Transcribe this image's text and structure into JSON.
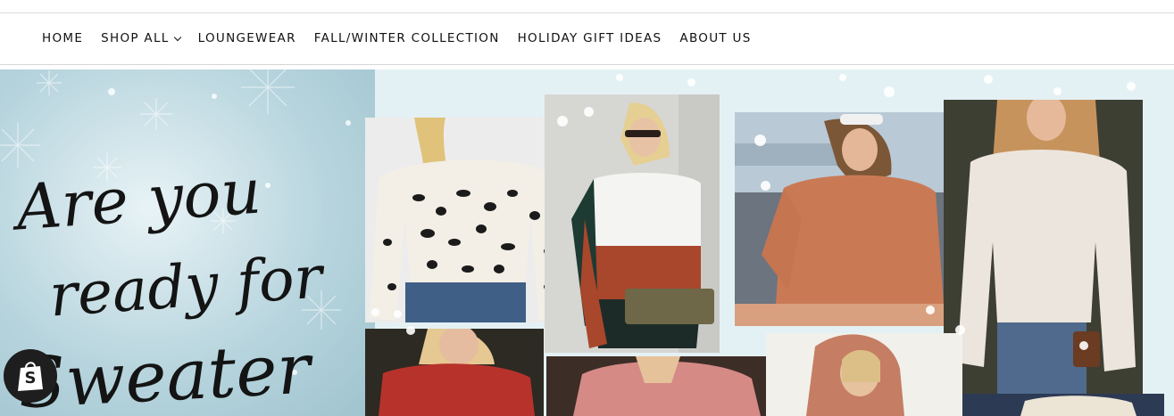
{
  "nav": {
    "items": [
      {
        "label": "HOME"
      },
      {
        "label": "SHOP ALL",
        "has_dropdown": true
      },
      {
        "label": "LOUNGEWEAR"
      },
      {
        "label": "FALL/WINTER COLLECTION"
      },
      {
        "label": "HOLIDAY GIFT IDEAS"
      },
      {
        "label": "ABOUT US"
      }
    ],
    "dropdown_icon": "chevron-down-icon"
  },
  "hero": {
    "headline_lines": [
      "Are you",
      "ready for",
      "Sweater"
    ]
  },
  "shopify_badge": {
    "icon": "shopify-bag-icon",
    "letter": "S"
  },
  "colors": {
    "nav_text": "#111111",
    "hero_bg": "#dceef1",
    "script_text": "#141414"
  }
}
